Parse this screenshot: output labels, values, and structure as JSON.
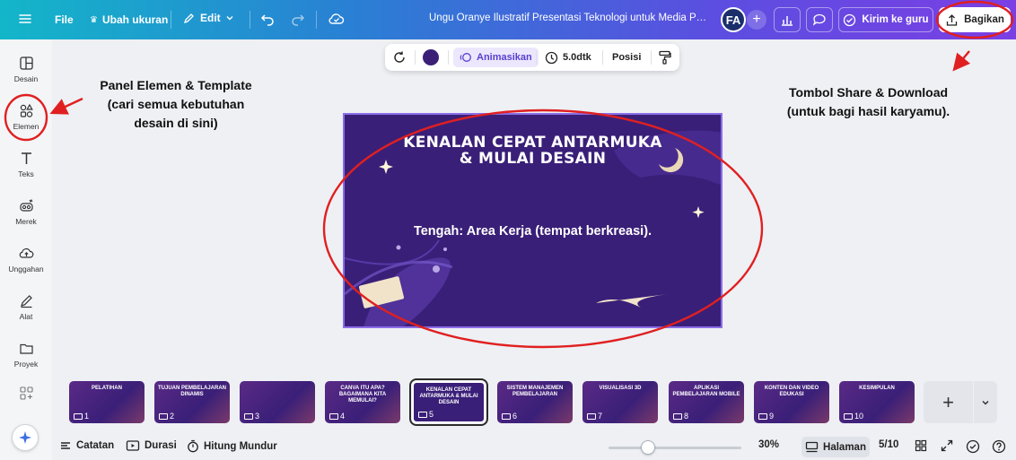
{
  "topbar": {
    "file_label": "File",
    "resize_label": "Ubah ukuran",
    "edit_label": "Edit",
    "doc_title": "Ungu Oranye Ilustratif Presentasi Teknologi untuk Media Pe...",
    "avatar_initials": "FA",
    "send_label": "Kirim ke guru",
    "share_label": "Bagikan"
  },
  "sidebar": {
    "items": [
      {
        "label": "Desain",
        "icon": "layout-icon"
      },
      {
        "label": "Elemen",
        "icon": "shapes-icon"
      },
      {
        "label": "Teks",
        "icon": "text-icon"
      },
      {
        "label": "Merek",
        "icon": "brand-icon"
      },
      {
        "label": "Unggahan",
        "icon": "cloud-upload-icon"
      },
      {
        "label": "Alat",
        "icon": "pen-icon"
      },
      {
        "label": "Proyek",
        "icon": "folder-icon"
      }
    ]
  },
  "floating_toolbar": {
    "color": "#3b1f77",
    "animate_label": "Animasikan",
    "duration_label": "5.0dtk",
    "position_label": "Posisi"
  },
  "slide": {
    "title_line1": "KENALAN CEPAT ANTARMUKA",
    "title_line2": "& MULAI DESAIN",
    "center_text": "Tengah: Area Kerja (tempat berkreasi)."
  },
  "annotations": {
    "left_line1": "Panel Elemen & Template",
    "left_line2": "(cari semua kebutuhan",
    "left_line3": "desain di sini)",
    "right_line1": "Tombol Share & Download",
    "right_line2": "(untuk bagi hasil karyamu)."
  },
  "thumbnails": [
    {
      "num": "1",
      "title": "PELATIHAN"
    },
    {
      "num": "2",
      "title": "TUJUAN PEMBELAJARAN DINAMIS"
    },
    {
      "num": "3",
      "title": ""
    },
    {
      "num": "4",
      "title": "CANVA ITU APA? BAGAIMANA KITA MEMULAI?"
    },
    {
      "num": "5",
      "title": "KENALAN CEPAT ANTARMUKA & MULAI DESAIN"
    },
    {
      "num": "6",
      "title": "SISTEM MANAJEMEN PEMBELAJARAN"
    },
    {
      "num": "7",
      "title": "VISUALISASI 3D"
    },
    {
      "num": "8",
      "title": "APLIKASI PEMBELAJARAN MOBILE"
    },
    {
      "num": "9",
      "title": "KONTEN DAN VIDEO EDUKASI"
    },
    {
      "num": "10",
      "title": "KESIMPULAN"
    }
  ],
  "bottombar": {
    "notes_label": "Catatan",
    "duration_label": "Durasi",
    "countdown_label": "Hitung Mundur",
    "zoom": "30%",
    "pages_label": "Halaman",
    "page_count": "5/10"
  },
  "colors": {
    "highlight_red": "#e02020",
    "slide_bg": "#3a1f78",
    "accent_purple": "#7b3fe4"
  }
}
